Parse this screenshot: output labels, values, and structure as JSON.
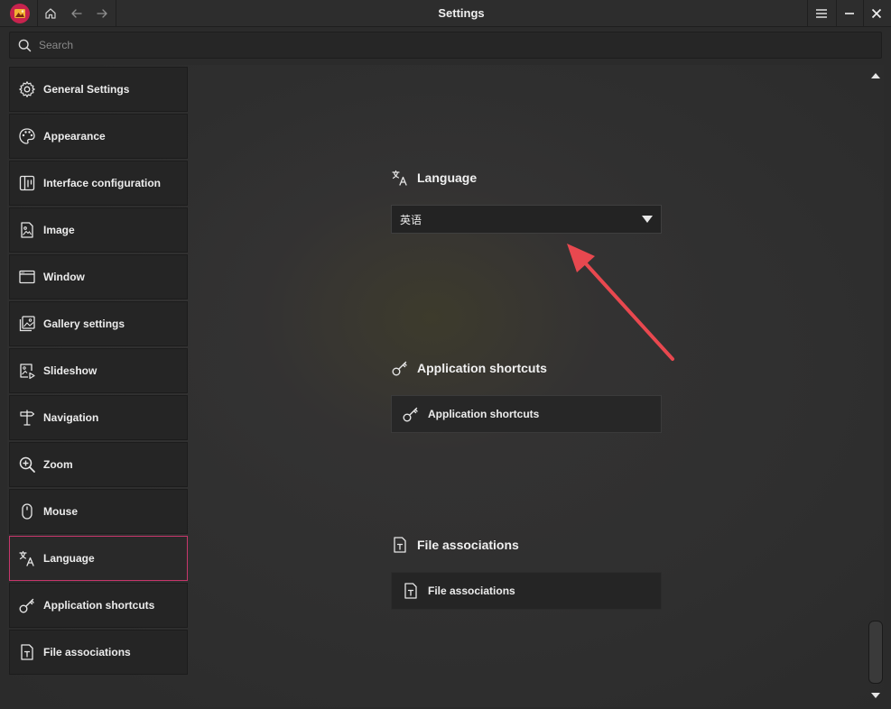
{
  "window": {
    "title": "Settings"
  },
  "search": {
    "placeholder": "Search"
  },
  "sidebar": {
    "items": [
      {
        "label": "General Settings",
        "icon": "gear-icon"
      },
      {
        "label": "Appearance",
        "icon": "palette-icon"
      },
      {
        "label": "Interface configuration",
        "icon": "interface-icon"
      },
      {
        "label": "Image",
        "icon": "image-icon"
      },
      {
        "label": "Window",
        "icon": "window-icon"
      },
      {
        "label": "Gallery settings",
        "icon": "gallery-icon"
      },
      {
        "label": "Slideshow",
        "icon": "slideshow-icon"
      },
      {
        "label": "Navigation",
        "icon": "signpost-icon"
      },
      {
        "label": "Zoom",
        "icon": "zoom-icon"
      },
      {
        "label": "Mouse",
        "icon": "mouse-icon"
      },
      {
        "label": "Language",
        "icon": "translate-icon",
        "active": true
      },
      {
        "label": "Application shortcuts",
        "icon": "key-icon"
      },
      {
        "label": "File associations",
        "icon": "file-text-icon"
      }
    ]
  },
  "content": {
    "language": {
      "heading": "Language",
      "selected_value": "英语"
    },
    "shortcuts": {
      "heading": "Application shortcuts",
      "button_label": "Application shortcuts"
    },
    "file_assoc": {
      "heading": "File associations",
      "button_label": "File associations"
    }
  },
  "colors": {
    "accent": "#c7366b",
    "annotation_arrow": "#e8484f",
    "background": "#2b2b2b"
  }
}
